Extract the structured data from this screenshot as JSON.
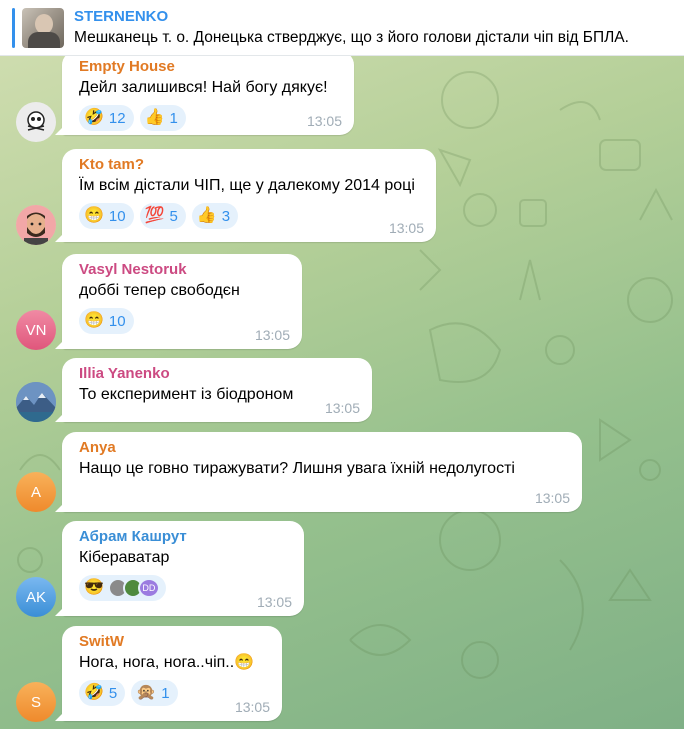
{
  "pinned": {
    "title": "STERNENKO",
    "text": "Мешканець т. о. Донецька стверджує, що з його голови дістали чіп від БПЛА."
  },
  "colors": {
    "accent": "#3390ec",
    "reaction_bg": "#e5f1fc",
    "time": "#a0acb6"
  },
  "messages": [
    {
      "author": "Empty House",
      "author_color": "#e17a24",
      "text": "Дейл залишився! Най богу дякує!",
      "time": "13:05",
      "avatar_icon": "skull-icon",
      "reactions": [
        {
          "emoji": "🤣",
          "count": "12"
        },
        {
          "emoji": "👍",
          "count": "1"
        }
      ]
    },
    {
      "author": "Kto tam?",
      "author_color": "#e17a24",
      "text": "Їм всім дістали ЧІП, ще у далекому 2014 році",
      "time": "13:05",
      "avatar_icon": "man-icon",
      "reactions": [
        {
          "emoji": "😁",
          "count": "10"
        },
        {
          "emoji": "💯",
          "count": "5"
        },
        {
          "emoji": "👍",
          "count": "3"
        }
      ]
    },
    {
      "author": "Vasyl Nestoruk",
      "author_color": "#cc4a82",
      "avatar_initials": "VN",
      "text": "доббі тепер свободєн",
      "time": "13:05",
      "reactions": [
        {
          "emoji": "😁",
          "count": "10"
        }
      ]
    },
    {
      "author": "Illia Yanenko",
      "author_color": "#cc4a82",
      "text": "То експеримент із біодроном",
      "time": "13:05",
      "avatar_icon": "landscape-icon",
      "reactions": []
    },
    {
      "author": "Anya",
      "author_color": "#e17a24",
      "avatar_initials": "A",
      "text": "Нащо це говно тиражувати? Лишня увага їхній недолугості",
      "time": "13:05",
      "reactions": []
    },
    {
      "author": "Абрам Кашрут",
      "author_color": "#3a8ed6",
      "avatar_initials": "AK",
      "text": "Кібераватар",
      "time": "13:05",
      "reactions": [
        {
          "emoji": "😎",
          "count": ""
        }
      ],
      "reaction_avatars_label": "DD"
    },
    {
      "author": "SwitW",
      "author_color": "#e17a24",
      "avatar_initials": "S",
      "text": "Нога, нога, нога..чіп..😁",
      "time": "13:05",
      "reactions": [
        {
          "emoji": "🤣",
          "count": "5"
        },
        {
          "emoji": "🙊",
          "count": "1"
        }
      ]
    }
  ]
}
